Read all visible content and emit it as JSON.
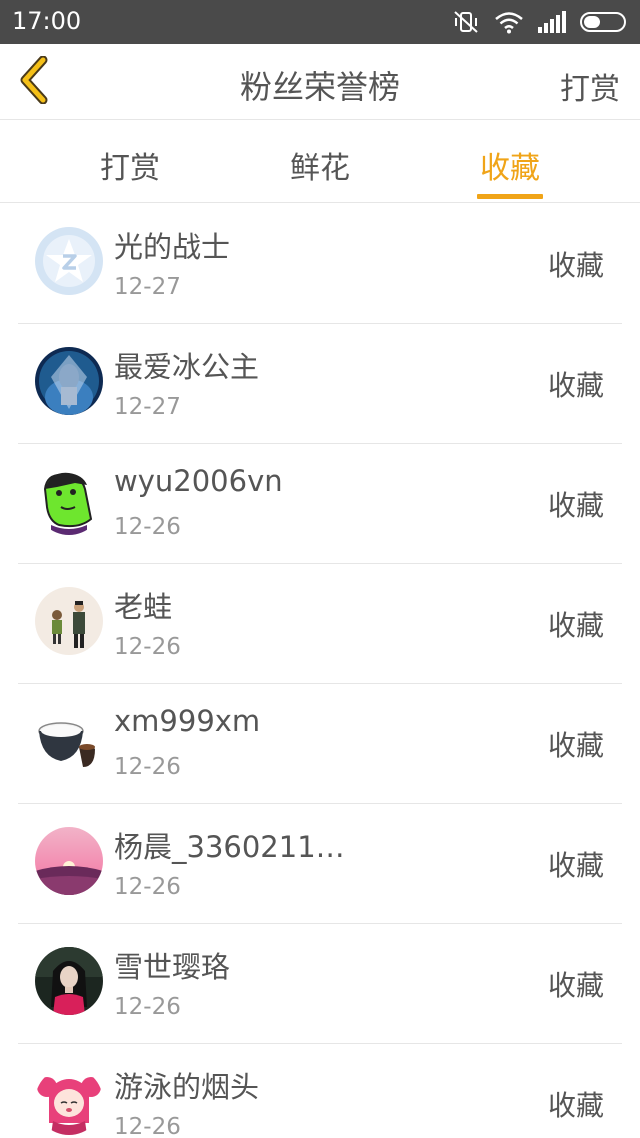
{
  "status_bar": {
    "time": "17:00",
    "icons": [
      "mute-vibrate-icon",
      "wifi-icon",
      "signal-icon",
      "battery-icon"
    ]
  },
  "nav": {
    "back_icon": "chevron-left-icon",
    "title": "粉丝荣誉榜",
    "action_label": "打赏"
  },
  "tabs": [
    {
      "label": "打赏",
      "active": false
    },
    {
      "label": "鲜花",
      "active": false
    },
    {
      "label": "收藏",
      "active": true
    }
  ],
  "colors": {
    "accent": "#f0a418",
    "status_bar": "#4a4a4a",
    "text": "#555555",
    "subtext": "#999999",
    "divider": "#e6e6e6"
  },
  "entries": [
    {
      "name": "光的战士",
      "date": "12-27",
      "action": "收藏",
      "avatar": "default-star-avatar"
    },
    {
      "name": "最爱冰公主",
      "date": "12-27",
      "action": "收藏",
      "avatar": "ice-princess-avatar"
    },
    {
      "name": "wyu2006vn",
      "date": "12-26",
      "action": "收藏",
      "avatar": "green-cartoon-avatar"
    },
    {
      "name": "老蛙",
      "date": "12-26",
      "action": "收藏",
      "avatar": "couple-illustration-avatar"
    },
    {
      "name": "xm999xm",
      "date": "12-26",
      "action": "收藏",
      "avatar": "rice-bowl-avatar"
    },
    {
      "name": "杨晨_3360211…",
      "date": "12-26",
      "action": "收藏",
      "avatar": "sunset-field-avatar"
    },
    {
      "name": "雪世璎珞",
      "date": "12-26",
      "action": "收藏",
      "avatar": "girl-photo-avatar"
    },
    {
      "name": "游泳的烟头",
      "date": "12-26",
      "action": "收藏",
      "avatar": "pink-anime-avatar"
    }
  ]
}
